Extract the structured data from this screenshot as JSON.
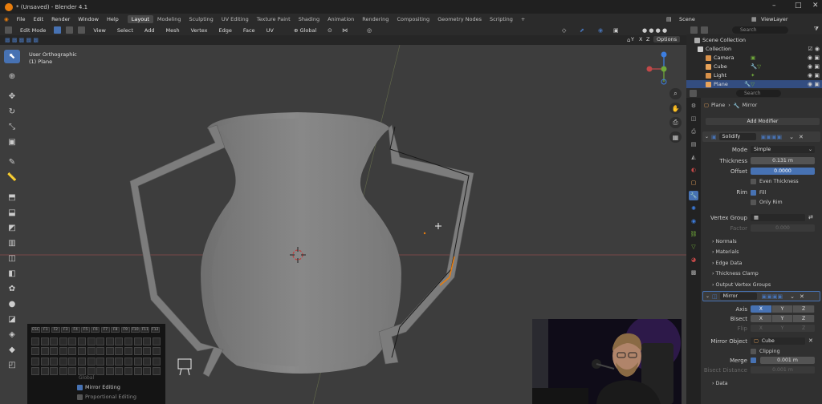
{
  "window": {
    "title": "* (Unsaved) - Blender 4.1"
  },
  "menu": [
    "File",
    "Edit",
    "Render",
    "Window",
    "Help"
  ],
  "workspaces": [
    "Layout",
    "Modeling",
    "Sculpting",
    "UV Editing",
    "Texture Paint",
    "Shading",
    "Animation",
    "Rendering",
    "Compositing",
    "Geometry Nodes",
    "Scripting",
    "+"
  ],
  "scene": "Scene",
  "view_layer": "ViewLayer",
  "vp_header": {
    "mode": "Edit Mode",
    "items": [
      "View",
      "Select",
      "Add",
      "Mesh",
      "Vertex",
      "Edge",
      "Face",
      "UV"
    ],
    "orientation": "Global",
    "options": "Options",
    "axes": [
      "X",
      "Y",
      "Z"
    ]
  },
  "viewport": {
    "view_name": "User Orthographic",
    "object_name": "(1) Plane"
  },
  "screencast": {
    "keys_row1": [
      "ESC",
      "F1",
      "F2",
      "F3",
      "F4",
      "F5",
      "F6",
      "F7",
      "F8",
      "F9",
      "F10",
      "F11",
      "F12"
    ],
    "mirror_editing": "Mirror Editing",
    "proportional_editing": "Proportional Editing",
    "global": "Global"
  },
  "outliner": {
    "search": "Search",
    "rows": [
      {
        "label": "Scene Collection",
        "indent": 0
      },
      {
        "label": "Collection",
        "indent": 1
      },
      {
        "label": "Camera",
        "indent": 2,
        "color": "#d8914a"
      },
      {
        "label": "Cube",
        "indent": 2,
        "color": "#e8a35a"
      },
      {
        "label": "Light",
        "indent": 2,
        "color": "#d8914a"
      },
      {
        "label": "Plane",
        "indent": 2,
        "color": "#e8a35a",
        "selected": true
      }
    ]
  },
  "properties": {
    "search": "Search",
    "breadcrumb_obj": "Plane",
    "breadcrumb_mod": "Mirror",
    "add_modifier": "Add Modifier",
    "solidify": {
      "name": "Solidify",
      "mode_label": "Mode",
      "mode": "Simple",
      "thickness_label": "Thickness",
      "thickness": "0.131 m",
      "offset_label": "Offset",
      "offset": "0.0000",
      "even_thickness": "Even Thickness",
      "rim_label": "Rim",
      "fill": "Fill",
      "only_rim": "Only Rim",
      "vgroup_label": "Vertex Group",
      "factor_label": "Factor",
      "factor": "0.000",
      "panels": [
        "Normals",
        "Materials",
        "Edge Data",
        "Thickness Clamp",
        "Output Vertex Groups"
      ]
    },
    "mirror": {
      "name": "Mirror",
      "axis_label": "Axis",
      "bisect_label": "Bisect",
      "flip_label": "Flip",
      "axes": [
        "X",
        "Y",
        "Z"
      ],
      "mirror_object_label": "Mirror Object",
      "mirror_object": "Cube",
      "clipping": "Clipping",
      "merge_label": "Merge",
      "merge": "0.001 m",
      "bisect_distance_label": "Bisect Distance",
      "bisect_distance": "0.001 m",
      "data_panel": "Data"
    }
  },
  "colors": {
    "accent": "#4772b3",
    "orange": "#e87d0d",
    "axis_red": "#c24848",
    "axis_green": "#6fa83a",
    "axis_blue": "#3d7ee0"
  }
}
